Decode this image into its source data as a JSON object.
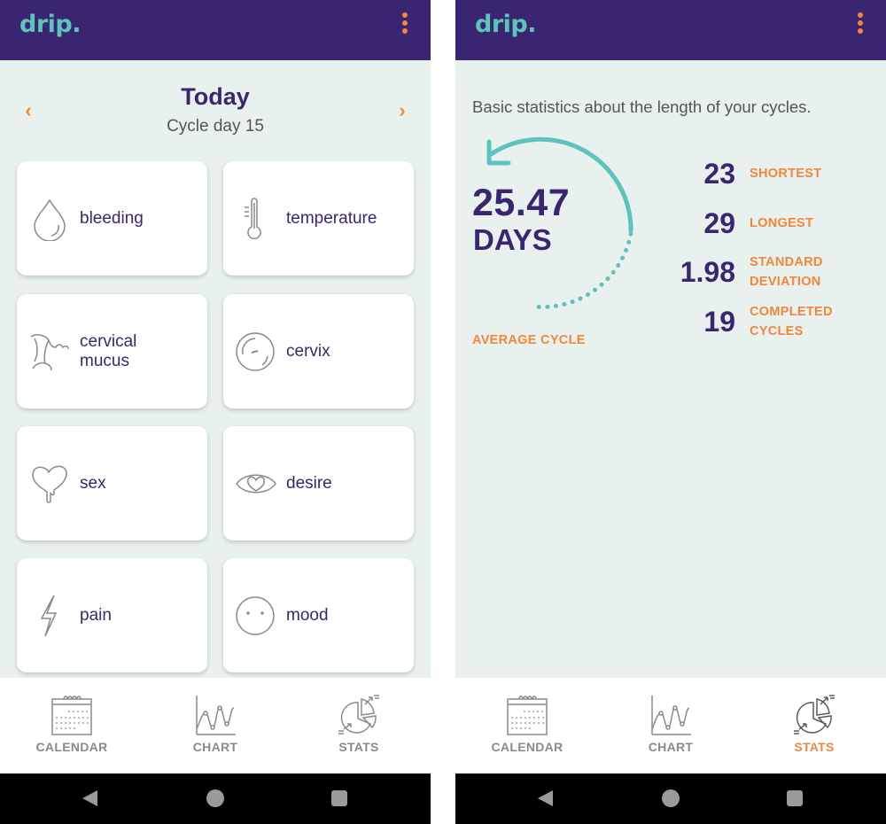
{
  "app": {
    "logo": "drip.",
    "menu_icon": "kebab-menu-icon"
  },
  "colors": {
    "primary": "#3a2670",
    "accent": "#f2863a",
    "teal": "#5dc4bc",
    "background": "#e8f1ed",
    "icon_gray": "#8a8a8a"
  },
  "left_screen": {
    "header": {
      "title": "Today",
      "subtitle": "Cycle day 15",
      "prev_icon": "chevron-left-icon",
      "next_icon": "chevron-right-icon",
      "prev_glyph": "‹",
      "next_glyph": "›"
    },
    "symptoms": [
      {
        "label": "bleeding",
        "icon": "drop-icon"
      },
      {
        "label": "temperature",
        "icon": "thermometer-icon"
      },
      {
        "label": "cervical mucus",
        "icon": "mucus-icon"
      },
      {
        "label": "cervix",
        "icon": "cervix-icon"
      },
      {
        "label": "sex",
        "icon": "heart-drip-icon"
      },
      {
        "label": "desire",
        "icon": "eye-heart-icon"
      },
      {
        "label": "pain",
        "icon": "lightning-icon"
      },
      {
        "label": "mood",
        "icon": "face-icon"
      }
    ]
  },
  "right_screen": {
    "intro": "Basic statistics about the length of your cycles.",
    "average": {
      "value": "25.47",
      "unit": "DAYS",
      "label": "AVERAGE CYCLE"
    },
    "stats": [
      {
        "value": "23",
        "label_line1": "SHORTEST",
        "label_line2": ""
      },
      {
        "value": "29",
        "label_line1": "LONGEST",
        "label_line2": ""
      },
      {
        "value": "1.98",
        "label_line1": "STANDARD",
        "label_line2": "DEVIATION"
      },
      {
        "value": "19",
        "label_line1": "COMPLETED",
        "label_line2": "CYCLES"
      }
    ]
  },
  "bottom_nav": {
    "items": [
      {
        "label": "CALENDAR",
        "icon": "calendar-icon"
      },
      {
        "label": "CHART",
        "icon": "chart-icon"
      },
      {
        "label": "STATS",
        "icon": "stats-icon"
      }
    ],
    "left_active": "none",
    "right_active": "STATS"
  },
  "system_nav": {
    "back": "back-icon",
    "home": "home-icon",
    "recents": "recents-icon"
  }
}
